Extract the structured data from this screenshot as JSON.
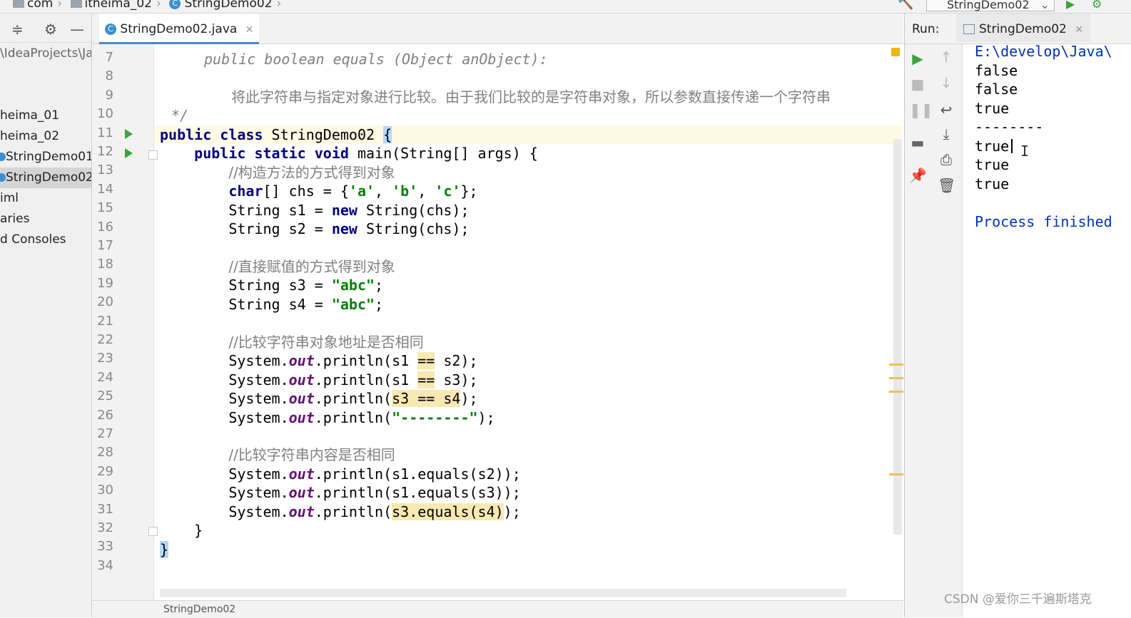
{
  "breadcrumb": [
    "com",
    "itheima_02",
    "StringDemo02"
  ],
  "run_config_label": "StringDemo02",
  "project": {
    "path": "\\IdeaProjects\\Ja",
    "items": [
      {
        "label": "heima_01",
        "selected": false
      },
      {
        "label": "heima_02",
        "selected": false
      },
      {
        "label": "StringDemo01",
        "selected": false
      },
      {
        "label": "StringDemo02",
        "selected": true
      },
      {
        "label": "iml",
        "selected": false
      },
      {
        "label": "aries",
        "selected": false
      },
      {
        "label": "d Consoles",
        "selected": false
      }
    ]
  },
  "editor": {
    "tab_label": "StringDemo02.java",
    "status_label": "StringDemo02",
    "line_numbers": [
      "7",
      "8",
      "9",
      "10",
      "11",
      "12",
      "13",
      "14",
      "15",
      "16",
      "17",
      "18",
      "19",
      "20",
      "21",
      "22",
      "23",
      "24",
      "25",
      "26",
      "27",
      "28",
      "29",
      "30",
      "31",
      "32",
      "33",
      "34"
    ],
    "doc_signature": "public boolean equals (Object anObject):",
    "doc_desc": "将此字符串与指定对象进行比较。由于我们比较的是字符串对象，所以参数直接传递一个字符串",
    "doc_end": "*/",
    "comment_construct": "//构造方法的方式得到对象",
    "comment_assign": "//直接赋值的方式得到对象",
    "comment_addr": "//比较字符串对象地址是否相同",
    "comment_content": "//比较字符串内容是否相同",
    "separator_literal": "\"--------\""
  },
  "run": {
    "label": "Run:",
    "tab_label": "StringDemo02",
    "output": [
      "E:\\develop\\Java\\",
      "false",
      "false",
      "true",
      "--------",
      "true",
      "true",
      "true",
      "",
      "Process finished"
    ]
  },
  "watermark": "CSDN @爱你三千遍斯塔克",
  "colors": {
    "keyword": "#000080",
    "string": "#008000",
    "field": "#660e7a",
    "comment": "#808080",
    "console_blue": "#0033b3",
    "run_green": "#3ca43c"
  }
}
